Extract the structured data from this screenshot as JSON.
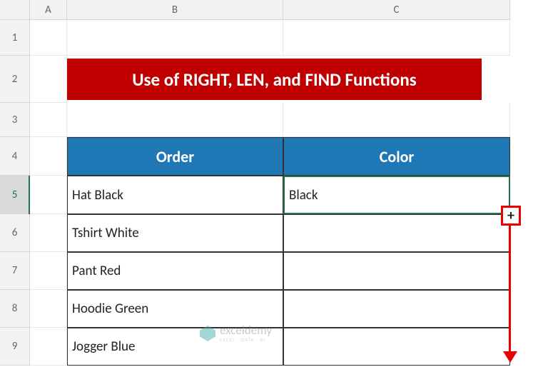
{
  "columns": [
    "A",
    "B",
    "C"
  ],
  "rows": [
    "1",
    "2",
    "3",
    "4",
    "5",
    "6",
    "7",
    "8",
    "9"
  ],
  "title": "Use of RIGHT, LEN, and FIND Functions",
  "headers": {
    "order": "Order",
    "color": "Color"
  },
  "table_data": [
    {
      "order": "Hat Black",
      "color": "Black"
    },
    {
      "order": "Tshirt White",
      "color": ""
    },
    {
      "order": "Pant Red",
      "color": ""
    },
    {
      "order": "Hoodie Green",
      "color": ""
    },
    {
      "order": "Jogger Blue",
      "color": ""
    }
  ],
  "fill_handle_symbol": "+",
  "watermark": {
    "name": "exceldemy",
    "tagline": "EXCEL · DATA · BI"
  },
  "selected_row": "5"
}
